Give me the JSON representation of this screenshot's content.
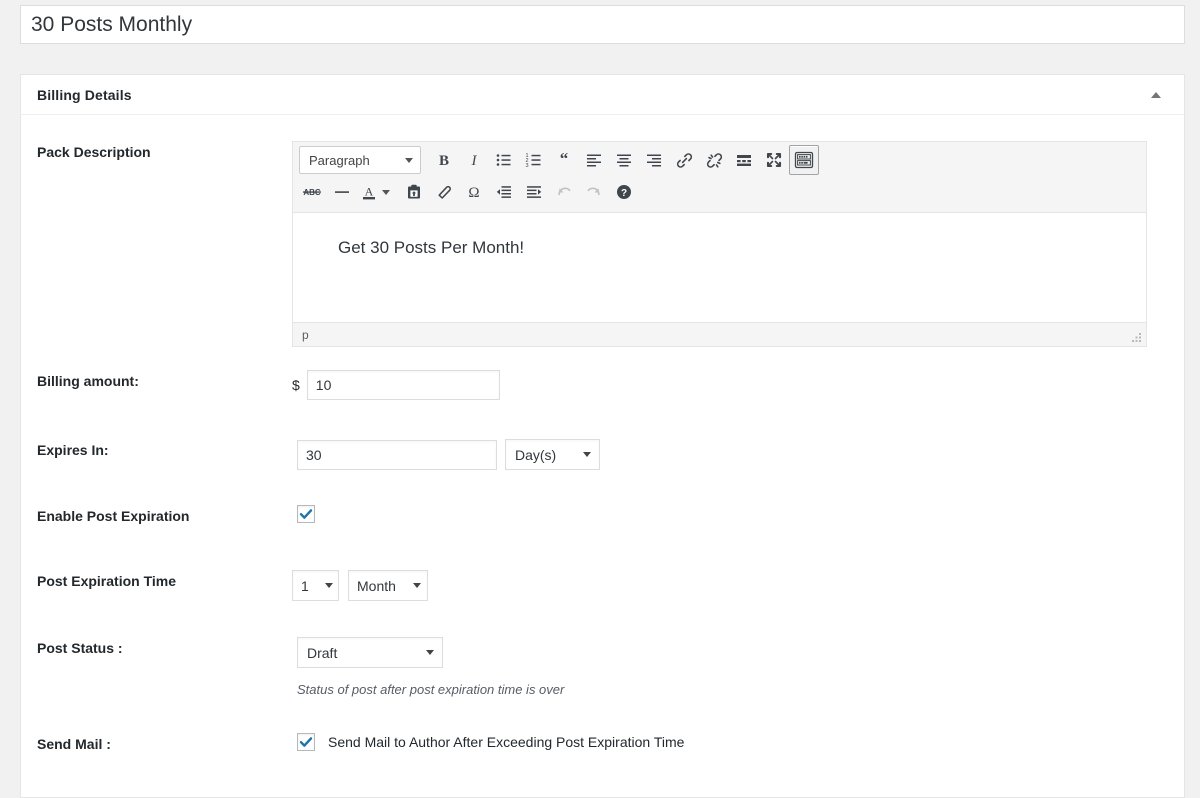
{
  "page": {
    "title_value": "30 Posts Monthly",
    "title_placeholder": "Enter title here"
  },
  "panel": {
    "heading": "Billing Details",
    "toggle_icon": "caret-up-icon"
  },
  "fields": {
    "pack_description": {
      "label": "Pack Description",
      "editor": {
        "format_select": "Paragraph",
        "body_text": "Get 30 Posts Per Month!",
        "status_path": "p",
        "toolbar_row1": [
          {
            "name": "bold-icon",
            "title": "Bold",
            "active": false
          },
          {
            "name": "italic-icon",
            "title": "Italic",
            "active": false
          },
          {
            "name": "bullet-list-icon",
            "title": "Bulleted list",
            "active": false
          },
          {
            "name": "numbered-list-icon",
            "title": "Numbered list",
            "active": false
          },
          {
            "name": "blockquote-icon",
            "title": "Blockquote",
            "active": false
          },
          {
            "name": "align-left-icon",
            "title": "Align left",
            "active": false
          },
          {
            "name": "align-center-icon",
            "title": "Align center",
            "active": false
          },
          {
            "name": "align-right-icon",
            "title": "Align right",
            "active": false
          },
          {
            "name": "link-icon",
            "title": "Insert/edit link",
            "active": false
          },
          {
            "name": "unlink-icon",
            "title": "Remove link",
            "active": false
          },
          {
            "name": "read-more-icon",
            "title": "Insert Read More tag",
            "active": false
          },
          {
            "name": "fullscreen-icon",
            "title": "Distraction-free writing mode",
            "active": false
          },
          {
            "name": "toolbar-toggle-icon",
            "title": "Toolbar Toggle",
            "active": true
          }
        ],
        "toolbar_row2": [
          {
            "name": "strikethrough-icon",
            "title": "Strikethrough",
            "disabled": false
          },
          {
            "name": "horizontal-rule-icon",
            "title": "Horizontal line",
            "disabled": false
          },
          {
            "name": "text-color-icon",
            "title": "Text color",
            "disabled": false
          },
          {
            "name": "paste-as-text-icon",
            "title": "Paste as text",
            "disabled": false
          },
          {
            "name": "clear-formatting-icon",
            "title": "Clear formatting",
            "disabled": false
          },
          {
            "name": "special-character-icon",
            "title": "Special character",
            "disabled": false
          },
          {
            "name": "outdent-icon",
            "title": "Decrease indent",
            "disabled": false
          },
          {
            "name": "indent-icon",
            "title": "Increase indent",
            "disabled": false
          },
          {
            "name": "undo-icon",
            "title": "Undo",
            "disabled": true
          },
          {
            "name": "redo-icon",
            "title": "Redo",
            "disabled": true
          },
          {
            "name": "help-icon",
            "title": "Keyboard Shortcuts",
            "disabled": false
          }
        ]
      }
    },
    "billing_amount": {
      "label": "Billing amount:",
      "currency_symbol": "$",
      "value": "10"
    },
    "expires_in": {
      "label": "Expires In:",
      "value": "30",
      "unit_selected": "Day(s)"
    },
    "enable_post_expiration": {
      "label": "Enable Post Expiration",
      "checked": true
    },
    "post_expiration_time": {
      "label": "Post Expiration Time",
      "number_selected": "1",
      "unit_selected": "Month"
    },
    "post_status": {
      "label": "Post Status :",
      "selected": "Draft",
      "hint": "Status of post after post expiration time is over"
    },
    "send_mail": {
      "label": "Send Mail :",
      "checkbox_label": "Send Mail to Author After Exceeding Post Expiration Time",
      "checked": true
    }
  },
  "colors": {
    "page_background": "#f1f1f1",
    "panel_background": "#ffffff",
    "panel_border": "#e5e5e5",
    "text_primary": "#23282d",
    "text_secondary": "#555d66",
    "checkbox_check": "#1e73aa",
    "toolbar_background": "#f5f5f5"
  }
}
